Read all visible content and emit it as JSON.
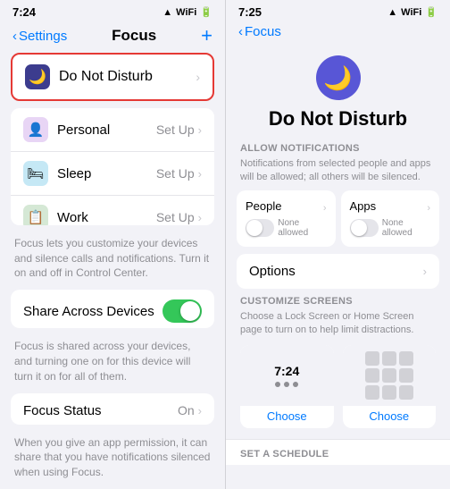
{
  "left": {
    "statusBar": {
      "time": "7:24",
      "icons": "▲ WiFi Cell Batt"
    },
    "navBack": "Settings",
    "navTitle": "Focus",
    "navAdd": "+",
    "doNotDisturb": {
      "label": "Do Not Disturb",
      "icon": "🌙"
    },
    "focusItems": [
      {
        "id": "personal",
        "icon": "👤",
        "iconBg": "#e8d5f5",
        "label": "Personal",
        "action": "Set Up"
      },
      {
        "id": "sleep",
        "icon": "🛏",
        "iconBg": "#c5e8f5",
        "label": "Sleep",
        "action": "Set Up"
      },
      {
        "id": "work",
        "icon": "📋",
        "iconBg": "#d5e8d5",
        "label": "Work",
        "action": "Set Up"
      }
    ],
    "focusDesc": "Focus lets you customize your devices and silence calls and notifications. Turn it on and off in Control Center.",
    "shareAcrossDevices": {
      "label": "Share Across Devices",
      "enabled": true
    },
    "shareDesc": "Focus is shared across your devices, and turning one on for this device will turn it on for all of them.",
    "focusStatus": {
      "label": "Focus Status",
      "action": "On"
    },
    "focusStatusDesc": "When you give an app permission, it can share that you have notifications silenced when using Focus."
  },
  "right": {
    "statusBar": {
      "time": "7:25",
      "icons": "▲ WiFi Cell Batt"
    },
    "navBack": "Focus",
    "title": "Do Not Disturb",
    "moonIcon": "🌙",
    "allowNotifications": {
      "sectionTitle": "ALLOW NOTIFICATIONS",
      "desc": "Notifications from selected people and apps will be allowed; all others will be silenced.",
      "people": {
        "label": "People",
        "sub": "None allowed"
      },
      "apps": {
        "label": "Apps",
        "sub": "None allowed"
      }
    },
    "options": {
      "label": "Options"
    },
    "customizeScreens": {
      "sectionTitle": "CUSTOMIZE SCREENS",
      "desc": "Choose a Lock Screen or Home Screen page to turn on to help limit distractions.",
      "lockScreen": {
        "time": "7:24",
        "chooseLabel": "Choose"
      },
      "homeScreen": {
        "chooseLabel": "Choose"
      }
    },
    "setASchedule": {
      "sectionTitle": "SET A SCHEDULE"
    }
  }
}
